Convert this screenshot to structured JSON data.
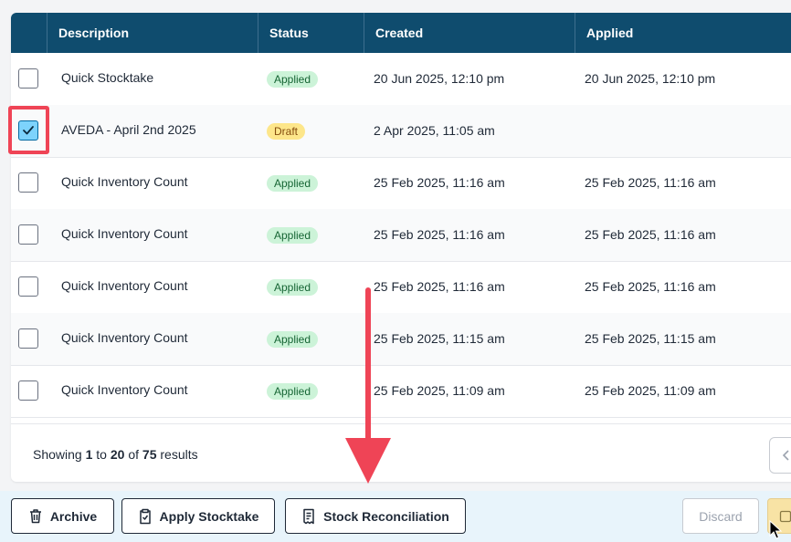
{
  "table": {
    "headers": [
      "Description",
      "Status",
      "Created",
      "Applied"
    ],
    "rows": [
      {
        "description": "Quick Stocktake",
        "status": "Applied",
        "created": "20 Jun 2025, 12:10 pm",
        "applied": "20 Jun 2025, 12:10 pm",
        "checked": false
      },
      {
        "description": "AVEDA - April 2nd 2025",
        "status": "Draft",
        "created": "2 Apr 2025, 11:05 am",
        "applied": "",
        "checked": true
      },
      {
        "description": "Quick Inventory Count",
        "status": "Applied",
        "created": "25 Feb 2025, 11:16 am",
        "applied": "25 Feb 2025, 11:16 am",
        "checked": false
      },
      {
        "description": "Quick Inventory Count",
        "status": "Applied",
        "created": "25 Feb 2025, 11:16 am",
        "applied": "25 Feb 2025, 11:16 am",
        "checked": false
      },
      {
        "description": "Quick Inventory Count",
        "status": "Applied",
        "created": "25 Feb 2025, 11:16 am",
        "applied": "25 Feb 2025, 11:16 am",
        "checked": false
      },
      {
        "description": "Quick Inventory Count",
        "status": "Applied",
        "created": "25 Feb 2025, 11:15 am",
        "applied": "25 Feb 2025, 11:15 am",
        "checked": false
      },
      {
        "description": "Quick Inventory Count",
        "status": "Applied",
        "created": "25 Feb 2025, 11:09 am",
        "applied": "25 Feb 2025, 11:09 am",
        "checked": false
      }
    ]
  },
  "pagination": {
    "showing": "Showing",
    "from": "1",
    "to_word": "to",
    "to": "20",
    "of_word": "of",
    "total": "75",
    "results_word": "results"
  },
  "actions": {
    "archive": "Archive",
    "apply_stocktake": "Apply Stocktake",
    "stock_reconciliation": "Stock Reconciliation",
    "discard": "Discard"
  },
  "colors": {
    "header_bg": "#0f4c6e",
    "applied_badge": "#ccf3d8",
    "draft_badge": "#fde68a",
    "annotation": "#ef4456"
  },
  "icons": [
    "trash-icon",
    "clipboard-check-icon",
    "receipt-icon",
    "chevron-left-icon",
    "checkmark-icon",
    "mouse-cursor-icon"
  ]
}
